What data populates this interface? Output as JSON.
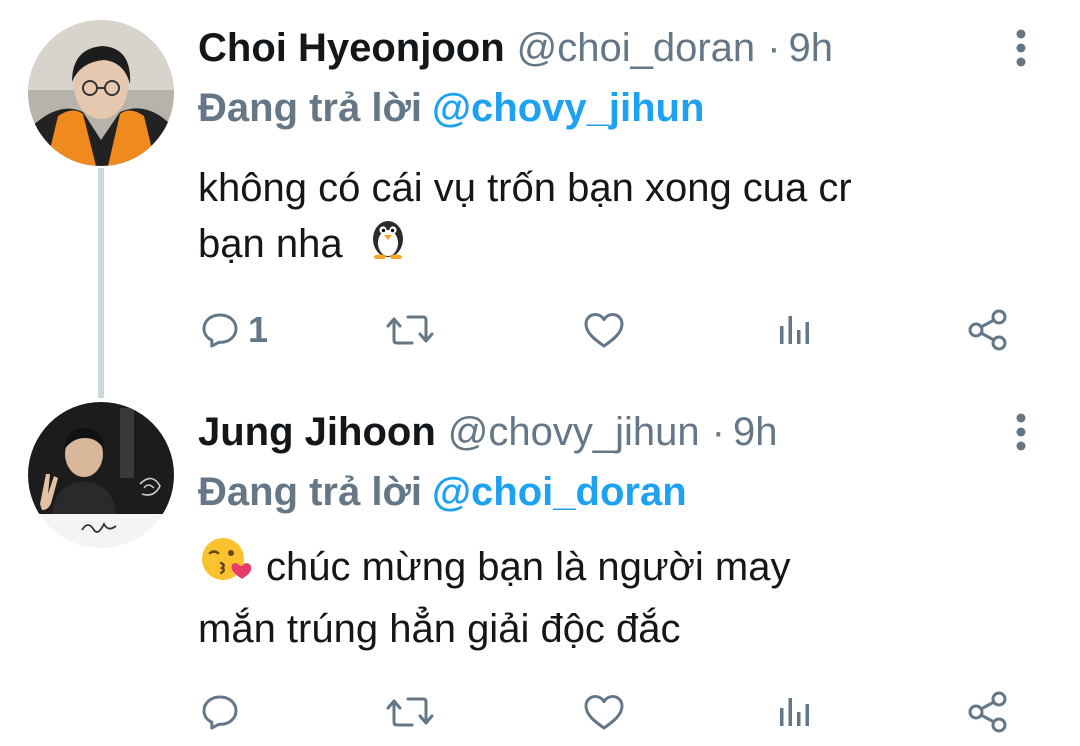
{
  "tweets": [
    {
      "name": "Choi Hyeonjoon",
      "handle": "@choi_doran",
      "time": "9h",
      "separator": "·",
      "replying_prefix": "Đang trả lời",
      "replying_to": "@chovy_jihun",
      "text_lines": [
        "không có cái vụ trốn bạn xong cua cr",
        "bạn nha"
      ],
      "emoji": "penguin-emoji",
      "reply_count": "1",
      "avatar_icon": "avatar-photo-orange-jacket"
    },
    {
      "name": "Jung Jihoon",
      "handle": "@chovy_jihun",
      "time": "9h",
      "separator": "·",
      "replying_prefix": "Đang trả lời",
      "replying_to": "@choi_doran",
      "text_lines": [
        "chúc mừng bạn là người may",
        "mắn trúng hẳn giải độc đắc"
      ],
      "emoji": "face-blowing-kiss-emoji",
      "reply_count": "",
      "avatar_icon": "avatar-photo-peace-sign"
    }
  ],
  "colors": {
    "name": "#14171a",
    "meta": "#657786",
    "mention": "#1da1f2",
    "thread_line": "#ccd6dd",
    "icon": "#657786"
  }
}
